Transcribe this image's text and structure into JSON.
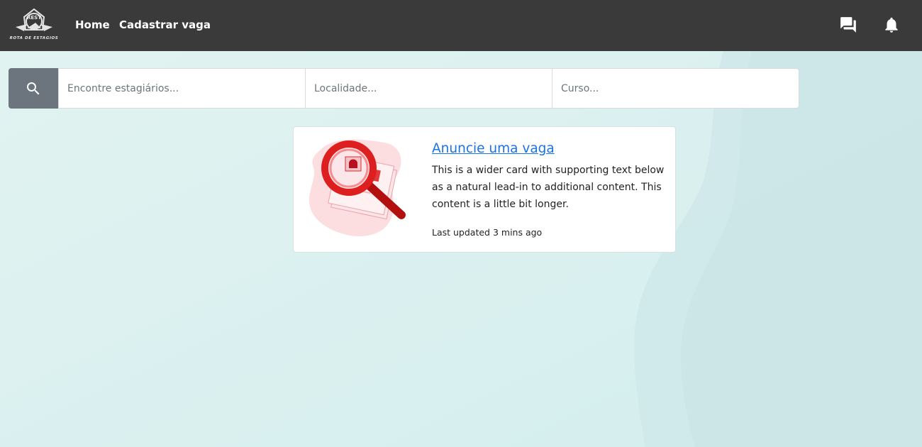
{
  "navbar": {
    "logo_top_text": "REST",
    "logo_text": "ROTA DE ESTAGIOS",
    "links": [
      {
        "label": "Home"
      },
      {
        "label": "Cadastrar vaga"
      }
    ],
    "icons": [
      "chat-icon",
      "bell-icon"
    ],
    "background": "#3a3a3a"
  },
  "search": {
    "button_icon": "search-icon",
    "fields": [
      {
        "placeholder": "Encontre estagiários...",
        "value": ""
      },
      {
        "placeholder": "Localidade...",
        "value": ""
      },
      {
        "placeholder": "Curso...",
        "value": ""
      }
    ],
    "button_color": "#6c757d"
  },
  "card": {
    "title": "Anuncie uma vaga",
    "text": "This is a wider card with supporting text below as a natural lead-in to additional content. This content is a little bit longer.",
    "updated": "Last updated 3 mins ago",
    "image_icon": "magnifier-on-documents-illustration",
    "title_color": "#1a73e8"
  },
  "colors": {
    "background": "#dbf0f0",
    "accent_red": "#d81b1b"
  }
}
